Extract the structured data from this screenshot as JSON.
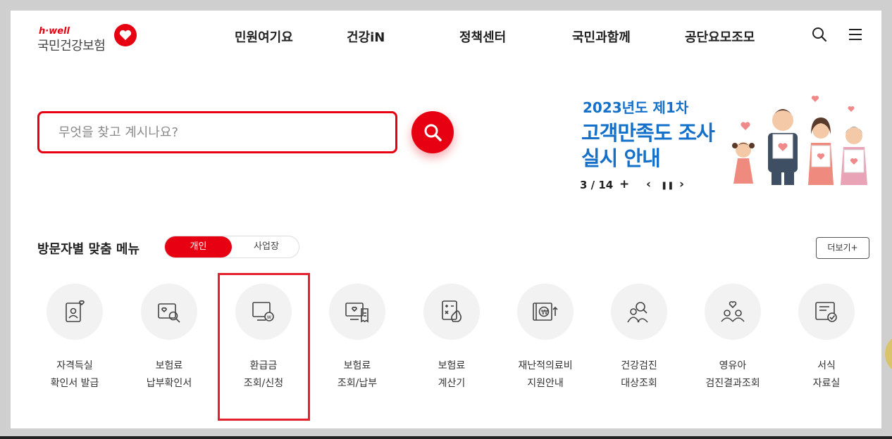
{
  "logo": {
    "brand_small": "h·well",
    "brand_name": "국민건강보험"
  },
  "nav": [
    "민원여기요",
    "건강iN",
    "정책센터",
    "국민과함께",
    "공단요모조모"
  ],
  "search": {
    "placeholder": "무엇을 찾고 계시나요?"
  },
  "banner": {
    "line1": "2023년도 제1차",
    "line2": "고객만족도 조사",
    "line3": "실시 안내",
    "pager": "3 / 14",
    "plus": "+",
    "prev": "‹",
    "pause": "❚❚",
    "next": "›"
  },
  "menu_section": {
    "title": "방문자별 맞춤 메뉴",
    "toggle": {
      "active": "개인",
      "inactive": "사업장"
    },
    "more_label": "더보기+",
    "items": [
      {
        "line1": "자격득실",
        "line2": "확인서 발급",
        "icon": "id-card-heart-icon"
      },
      {
        "line1": "보험료",
        "line2": "납부확인서",
        "icon": "search-document-icon"
      },
      {
        "line1": "환급금",
        "line2": "조회/신청",
        "icon": "refund-monitor-icon"
      },
      {
        "line1": "보험료",
        "line2": "조회/납부",
        "icon": "monitor-receipt-icon"
      },
      {
        "line1": "보험료",
        "line2": "계산기",
        "icon": "calculator-icon"
      },
      {
        "line1": "재난적의료비",
        "line2": "지원안내",
        "icon": "disaster-support-icon"
      },
      {
        "line1": "건강검진",
        "line2": "대상조회",
        "icon": "people-search-icon"
      },
      {
        "line1": "영유아",
        "line2": "검진결과조회",
        "icon": "family-heart-icon"
      },
      {
        "line1": "서식",
        "line2": "자료실",
        "icon": "form-document-icon"
      }
    ]
  },
  "colors": {
    "brand_red": "#e60012",
    "banner_blue": "#1570c9",
    "highlight_red": "#e3202b"
  }
}
